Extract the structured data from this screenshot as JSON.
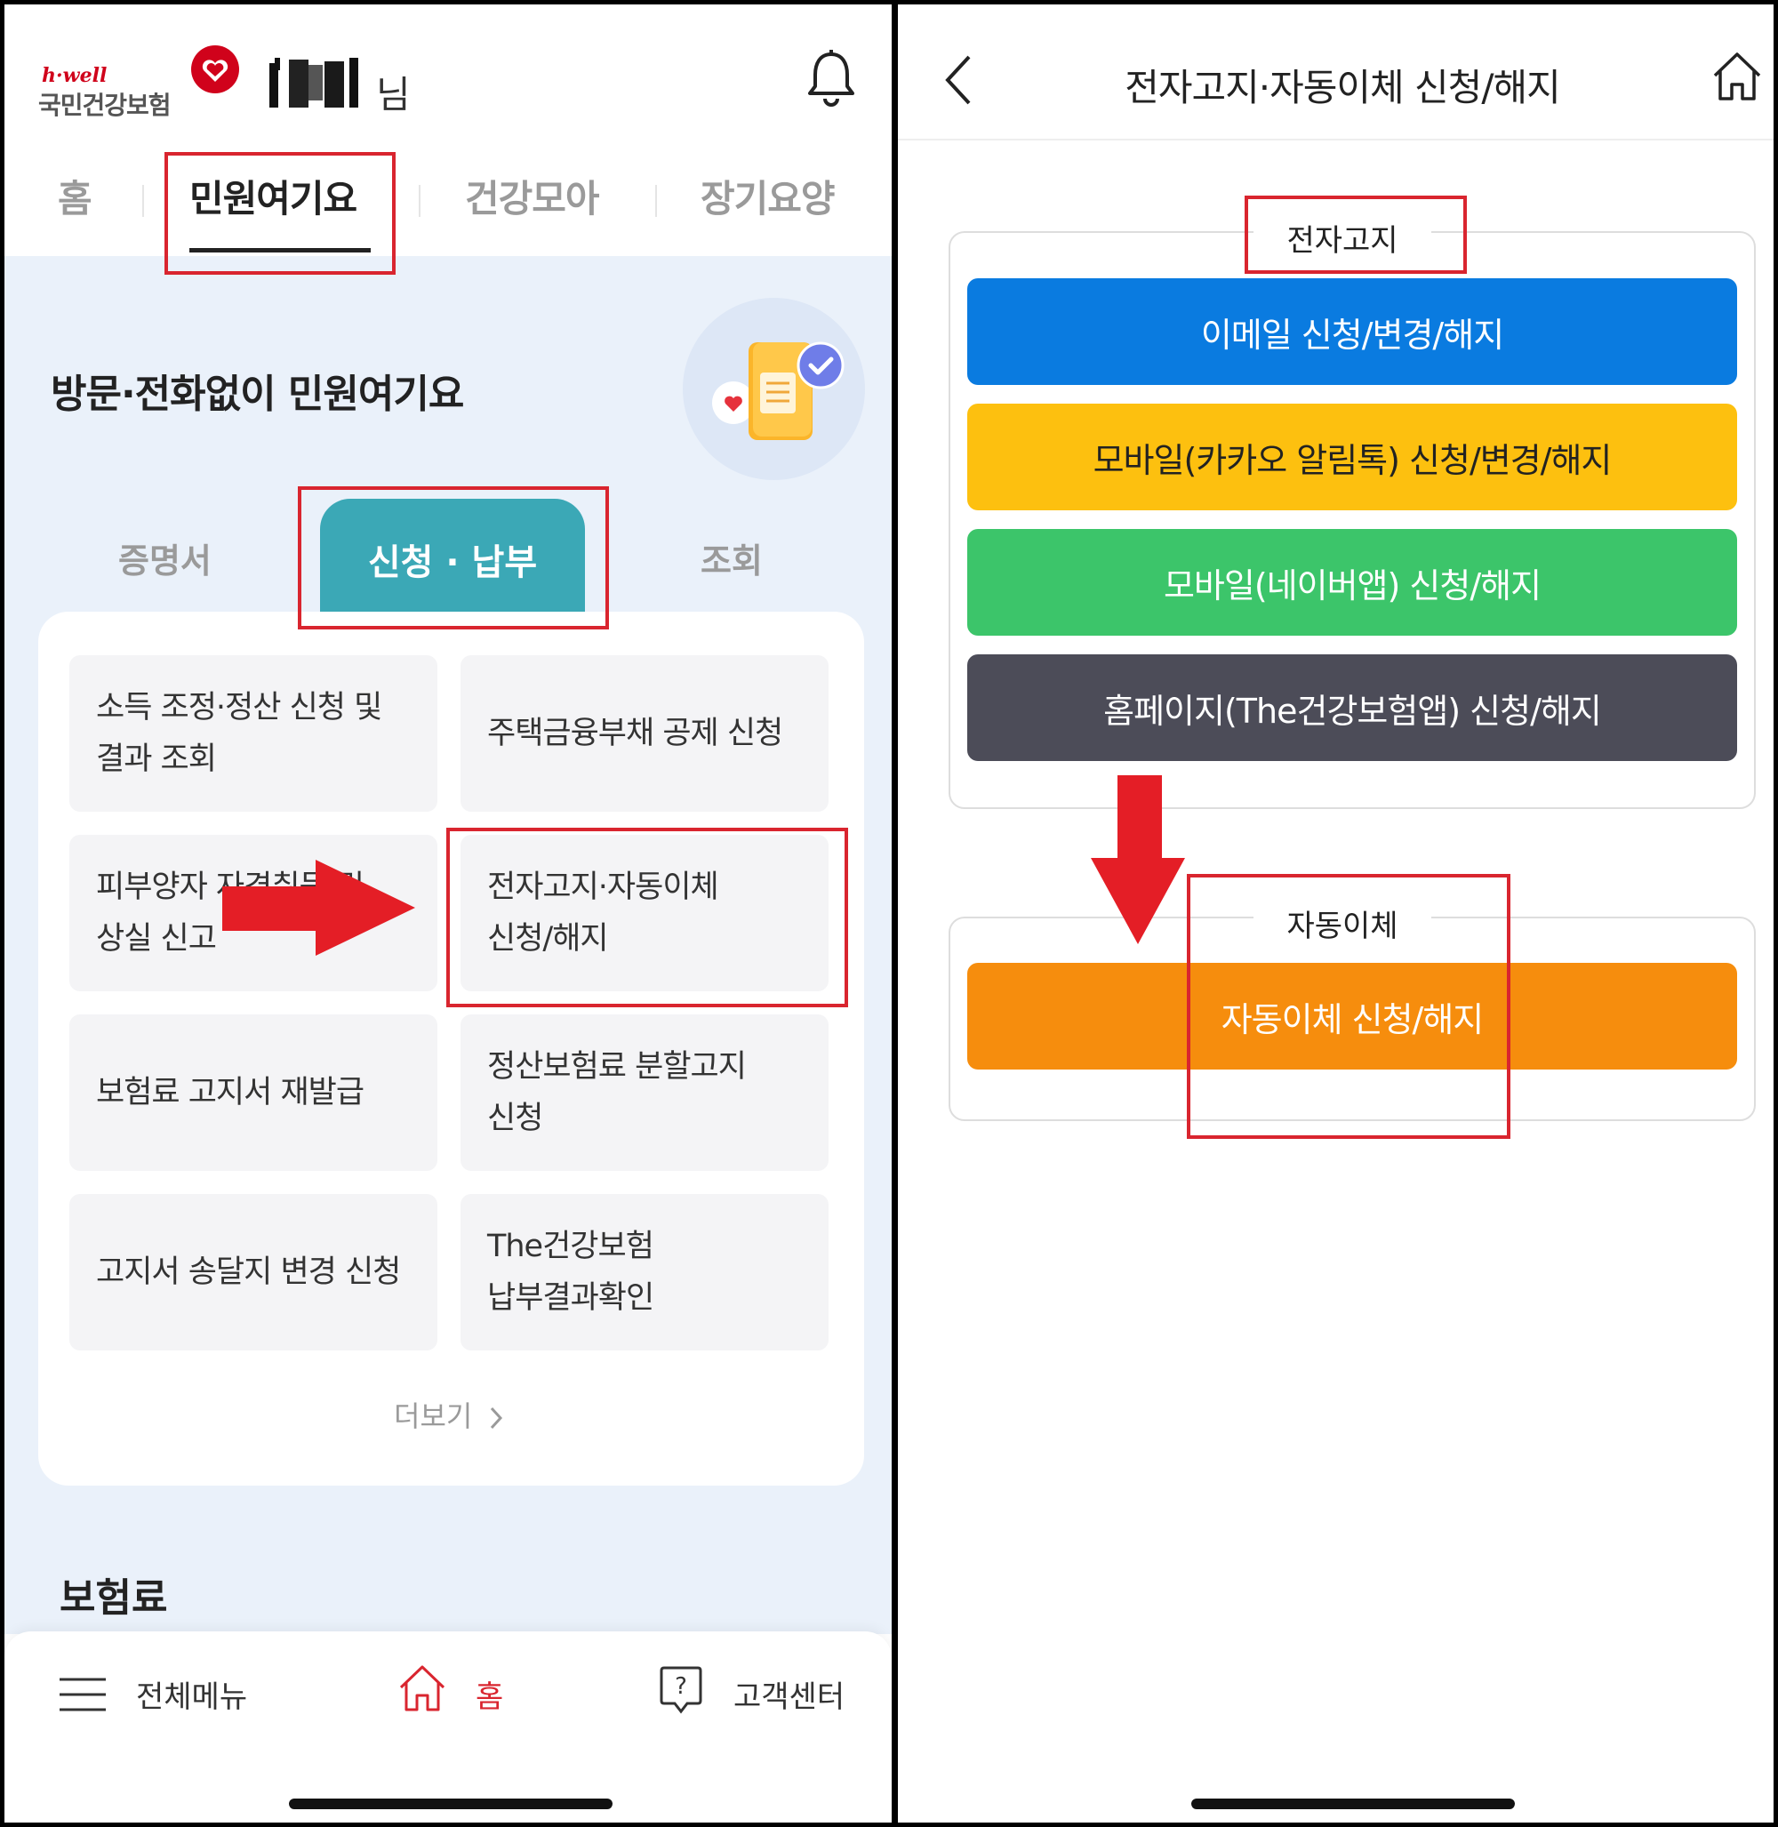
{
  "left": {
    "logo": {
      "brand_small": "h·well",
      "name": "국민건강보험"
    },
    "user": {
      "suffix": "님"
    },
    "tabs": [
      {
        "label": "홈"
      },
      {
        "label": "민원여기요"
      },
      {
        "label": "건강모아"
      },
      {
        "label": "장기요양"
      }
    ],
    "hero": {
      "title": "방문·전화없이 민원여기요"
    },
    "subtabs": [
      {
        "label": "증명서"
      },
      {
        "label": "신청 · 납부"
      },
      {
        "label": "조회"
      }
    ],
    "tiles": [
      {
        "line1": "소득 조정·정산 신청 및",
        "line2": "결과 조회"
      },
      {
        "line1": "주택금융부채 공제 신청",
        "line2": ""
      },
      {
        "line1": "피부양자 자격취득 및",
        "line2": "상실 신고"
      },
      {
        "line1": "전자고지·자동이체",
        "line2": "신청/해지"
      },
      {
        "line1": "보험료 고지서 재발급",
        "line2": ""
      },
      {
        "line1": "정산보험료 분할고지",
        "line2": "신청"
      },
      {
        "line1": "고지서 송달지 변경 신청",
        "line2": ""
      },
      {
        "line1": "The건강보험",
        "line2": "납부결과확인"
      }
    ],
    "more": "더보기",
    "section_title": "보험료",
    "bottom_nav": {
      "menu": "전체메뉴",
      "home": "홈",
      "support": "고객센터"
    }
  },
  "right": {
    "header_title": "전자고지·자동이체 신청/해지",
    "e_notice": {
      "legend": "전자고지",
      "buttons": [
        {
          "label": "이메일 신청/변경/해지",
          "color": "#0a7be0"
        },
        {
          "label": "모바일(카카오 알림톡) 신청/변경/해지",
          "color": "#fdc00f"
        },
        {
          "label": "모바일(네이버앱) 신청/해지",
          "color": "#3cc56a"
        },
        {
          "label": "홈페이지(The건강보험앱) 신청/해지",
          "color": "#4c4c58"
        }
      ]
    },
    "auto_transfer": {
      "legend": "자동이체",
      "button": {
        "label": "자동이체 신청/해지",
        "color": "#f68d0d"
      }
    }
  },
  "colors": {
    "accent_red": "#d9252f",
    "teal": "#3ba8b6",
    "arrow_red": "#e41e26"
  }
}
